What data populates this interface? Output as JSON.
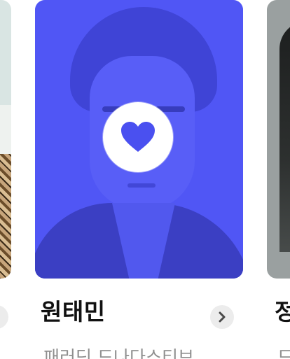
{
  "cards": {
    "main": {
      "name": "원태민",
      "subtitle": "패러딘 드나다스티브",
      "favorited": true,
      "accent_color": "#5057f5"
    },
    "right": {
      "name_partial": "정",
      "subtitle_partial": "드"
    }
  },
  "icons": {
    "favorite": "heart-icon",
    "next": "chevron-right-icon"
  },
  "colors": {
    "card_tint": "#5057f5",
    "heart": "#4a50f0",
    "chevron_bg": "#ececec",
    "chevron": "#4a4a4a",
    "name_text": "#111111",
    "subtitle_text": "#8f8f8f"
  }
}
